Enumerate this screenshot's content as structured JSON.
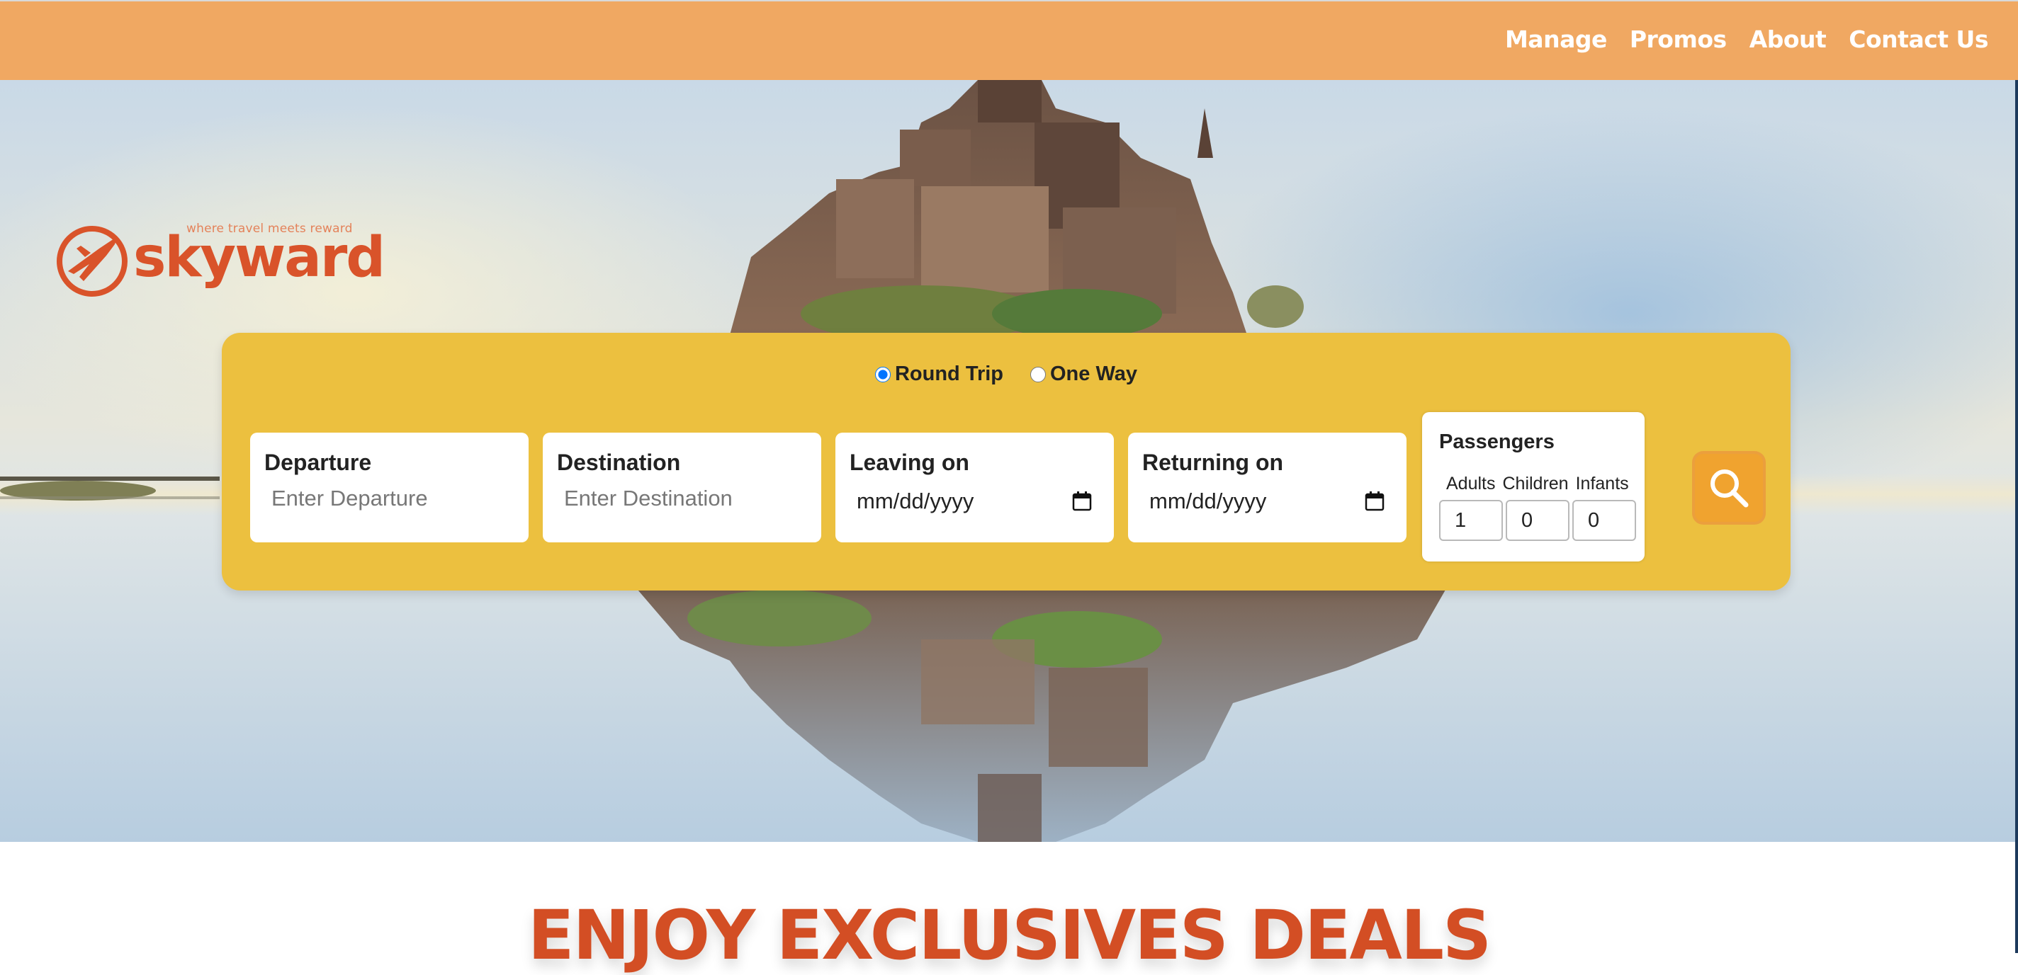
{
  "nav": {
    "items": [
      {
        "label": "Manage"
      },
      {
        "label": "Promos"
      },
      {
        "label": "About"
      },
      {
        "label": "Contact Us"
      }
    ]
  },
  "brand": {
    "name": "skyward",
    "tagline": "where travel meets reward",
    "color": "#d9532a"
  },
  "hero": {
    "image": "castle-island-reflection"
  },
  "search": {
    "trip_types": [
      {
        "label": "Round Trip",
        "selected": true
      },
      {
        "label": "One Way",
        "selected": false
      }
    ],
    "departure": {
      "label": "Departure",
      "placeholder": "Enter Departure"
    },
    "destination": {
      "label": "Destination",
      "placeholder": "Enter Destination"
    },
    "leaving": {
      "label": "Leaving on",
      "value": "mm/dd/yyyy"
    },
    "returning": {
      "label": "Returning on",
      "value": "mm/dd/yyyy"
    },
    "passengers": {
      "title": "Passengers",
      "adults_label": "Adults",
      "children_label": "Children",
      "infants_label": "Infants",
      "adults": "1",
      "children": "0",
      "infants": "0"
    },
    "search_icon": "search-icon"
  },
  "deals": {
    "title": "ENJOY EXCLUSIVES DEALS"
  },
  "colors": {
    "topbar": "#f0a862",
    "panel": "#ecc03f",
    "search_button": "#f0a32f",
    "deals_title": "#d34e24"
  }
}
